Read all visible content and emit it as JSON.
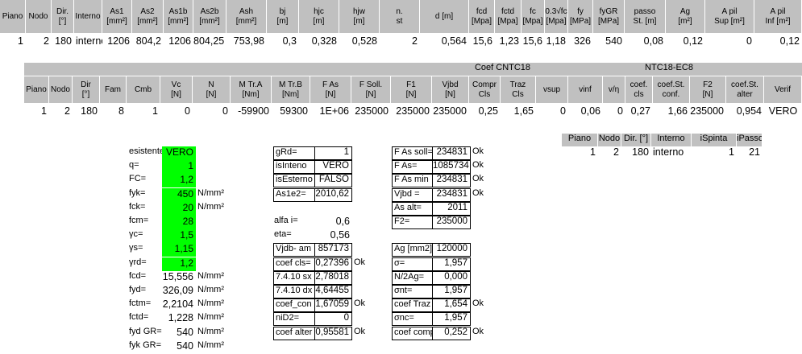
{
  "t1": {
    "headers": [
      [
        "Piano"
      ],
      [
        "Nodo"
      ],
      [
        "Dir.",
        "[°]"
      ],
      [
        "Interno"
      ],
      [
        "As1",
        "[mm²]"
      ],
      [
        "As2",
        "[mm²]"
      ],
      [
        "As1b",
        "[mm²]"
      ],
      [
        "As2b",
        "[mm²]"
      ],
      [
        "Ash",
        "[mm²]"
      ],
      [
        "bj",
        "[m]"
      ],
      [
        "hjc",
        "[m]"
      ],
      [
        "hjw",
        "[m]"
      ],
      [
        "n.",
        "st"
      ],
      [
        "d [m]"
      ],
      [
        "fcd",
        "[Mpa]"
      ],
      [
        "fctd",
        "[Mpa]"
      ],
      [
        "fc",
        "[Mpa]"
      ],
      [
        "0.3√fc",
        "[Mpa]"
      ],
      [
        "fy",
        "[MPa]"
      ],
      [
        "fyGR",
        "[MPa]"
      ],
      [
        "passo",
        "St. [m]"
      ],
      [
        "Ag",
        "[m²]"
      ],
      [
        "A pil",
        "Sup [m²]"
      ],
      [
        "A pil",
        "Inf [m²]"
      ]
    ],
    "row": [
      "1",
      "2",
      "180",
      "interno",
      "1206",
      "804,2",
      "1206",
      "804,25",
      "753,98",
      "0,3",
      "0,328",
      "0,528",
      "2",
      "0,564",
      "15,6",
      "1,23",
      "15,6",
      "1,18",
      "326",
      "540",
      "0,08",
      "0,12",
      "0",
      "0,12"
    ]
  },
  "t2": {
    "group_left": "Coef CNTC18",
    "group_right": "NTC18-EC8",
    "headers": [
      [
        "Piano"
      ],
      [
        "Nodo"
      ],
      [
        "Dir",
        "[°]"
      ],
      [
        "Fam"
      ],
      [
        "Cmb"
      ],
      [
        "Vc",
        "[N]"
      ],
      [
        "N",
        "[N]"
      ],
      [
        "M Tr.A",
        "[Nm]"
      ],
      [
        "M Tr.B",
        "[Nm]"
      ],
      [
        "F As",
        "[N]"
      ],
      [
        "F Soll.",
        "[N]"
      ],
      [
        "F1",
        "[N]"
      ],
      [
        "Vjbd",
        "[N]"
      ],
      [
        "Compr",
        "Cls"
      ],
      [
        "Traz",
        "Cls"
      ],
      [
        "vsup"
      ],
      [
        "vinf"
      ],
      [
        "v/η"
      ],
      [
        "coef.",
        "cls"
      ],
      [
        "coef.St.",
        "conf."
      ],
      [
        "F2",
        "[N]"
      ],
      [
        "coef.St.",
        "alter"
      ],
      [
        "Verif"
      ]
    ],
    "row": [
      "1",
      "2",
      "180",
      "8",
      "1",
      "0",
      "0",
      "-59900",
      "59300",
      "1E+06",
      "235000",
      "235000",
      "235000",
      "0,25",
      "1,65",
      "0",
      "0,06",
      "0",
      "0,27",
      "1,66",
      "235000",
      "0,954",
      "VERO"
    ]
  },
  "t3": {
    "headers": [
      "Piano",
      "Nodo",
      "Dir. [°]",
      "Interno",
      "iSpinta",
      "iPasso"
    ],
    "row": [
      "1",
      "2",
      "180",
      "interno",
      "1",
      "21"
    ]
  },
  "colA": [
    {
      "label": "esistente",
      "value": "VERO",
      "unit": "",
      "green": true
    },
    {
      "label": "q=",
      "value": "1",
      "unit": "",
      "green": true
    },
    {
      "label": "FC=",
      "value": "1,2",
      "unit": "",
      "green": true
    },
    {
      "label": "fyk=",
      "value": "450",
      "unit": "N/mm²",
      "green": true
    },
    {
      "label": "fck=",
      "value": "20",
      "unit": "N/mm²",
      "green": true
    },
    {
      "label": "fcm=",
      "value": "28",
      "unit": "",
      "green": true
    },
    {
      "label": "γc=",
      "value": "1,5",
      "unit": "",
      "green": true
    },
    {
      "label": "γs=",
      "value": "1,15",
      "unit": "",
      "green": true
    },
    {
      "label": "γrd=",
      "value": "1,2",
      "unit": "",
      "green": true
    },
    {
      "label": "fcd=",
      "value": "15,556",
      "unit": "N/mm²",
      "green": false
    },
    {
      "label": "fyd=",
      "value": "326,09",
      "unit": "N/mm²",
      "green": false
    },
    {
      "label": "fctm=",
      "value": "2,2104",
      "unit": "N/mm²",
      "green": false
    },
    {
      "label": "fctd=",
      "value": "1,228",
      "unit": "N/mm²",
      "green": false
    },
    {
      "label": "fyd GR=",
      "value": "540",
      "unit": "N/mm²",
      "green": false
    },
    {
      "label": "fyk GR=",
      "value": "540",
      "unit": "N/mm²",
      "green": false
    }
  ],
  "colB": [
    {
      "label": "gRd=",
      "value": "1",
      "ok": "",
      "boxed": true
    },
    {
      "label": "isInteno",
      "value": "VERO",
      "ok": "",
      "boxed": true,
      "center": true
    },
    {
      "label": "isEsterno",
      "value": "FALSO",
      "ok": "",
      "boxed": true,
      "center": true
    },
    {
      "label": "As1e2=",
      "value": "2010,62",
      "ok": "",
      "boxed": true
    },
    null,
    {
      "label": "alfa i=",
      "value": "0,6",
      "ok": "",
      "boxed": false
    },
    {
      "label": "eta=",
      "value": "0,56",
      "ok": "",
      "boxed": false
    },
    {
      "label": "Vjdb- am",
      "value": "857173",
      "ok": "",
      "boxed": true
    },
    {
      "label": "coef cls=",
      "value": "0,27396",
      "ok": "Ok",
      "boxed": true
    },
    {
      "label": "7.4.10 sx",
      "value": "2,78018",
      "ok": "",
      "boxed": true
    },
    {
      "label": "7.4.10 dx",
      "value": "4,64455",
      "ok": "",
      "boxed": true
    },
    {
      "label": "coef_con",
      "value": "1,67059",
      "ok": "Ok",
      "boxed": true
    },
    {
      "label": "niD2=",
      "value": "0",
      "ok": "",
      "boxed": true
    },
    {
      "label": "coef alter",
      "value": "0,95581",
      "ok": "Ok",
      "boxed": true
    }
  ],
  "colC": [
    {
      "label": "F As soll=",
      "value": "234831",
      "ok": "Ok"
    },
    {
      "label": "F As=",
      "value": "1085734",
      "ok": "Ok"
    },
    {
      "label": "F As min",
      "value": "234831",
      "ok": "Ok"
    },
    {
      "label": "Vjbd =",
      "value": "234831",
      "ok": "Ok"
    },
    {
      "label": "As alt=",
      "value": "2011",
      "ok": ""
    },
    {
      "label": "F2=",
      "value": "235000",
      "ok": ""
    },
    null,
    {
      "label": "Ag [mm2]",
      "value": "120000",
      "ok": ""
    },
    {
      "label": "σ=",
      "value": "1,957",
      "ok": ""
    },
    {
      "label": "N/2Ag=",
      "value": "0,000",
      "ok": ""
    },
    {
      "label": "σnt=",
      "value": "1,957",
      "ok": ""
    },
    {
      "label": "coef Traz",
      "value": "1,654",
      "ok": "Ok"
    },
    {
      "label": "σnc=",
      "value": "1,957",
      "ok": ""
    },
    {
      "label": "coef comp",
      "value": "0,252",
      "ok": "Ok"
    }
  ]
}
